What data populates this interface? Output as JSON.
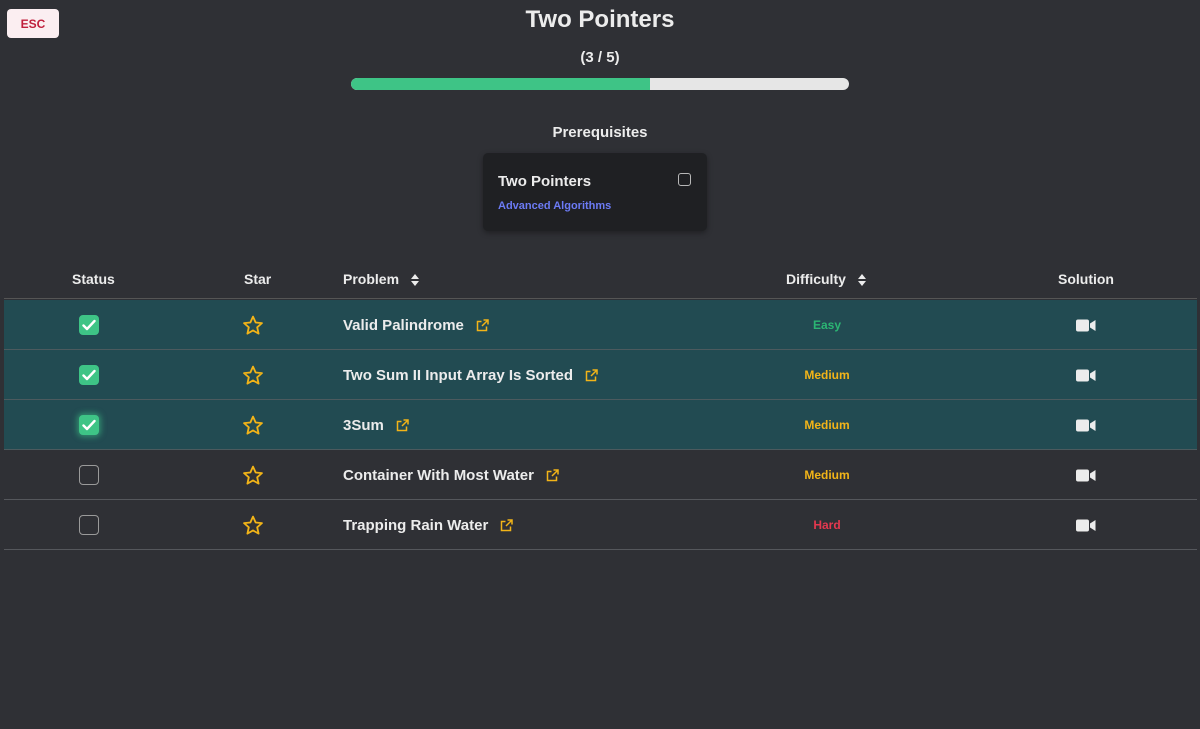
{
  "esc_label": "ESC",
  "title": "Two Pointers",
  "progress": {
    "text": "(3 / 5)",
    "completed": 3,
    "total": 5
  },
  "prerequisites": {
    "heading": "Prerequisites",
    "cards": [
      {
        "title": "Two Pointers",
        "subtitle": "Advanced Algorithms",
        "checked": false
      }
    ]
  },
  "table": {
    "headers": {
      "status": "Status",
      "star": "Star",
      "problem": "Problem",
      "difficulty": "Difficulty",
      "solution": "Solution"
    },
    "rows": [
      {
        "problem": "Valid Palindrome",
        "difficulty": "Easy",
        "completed": true
      },
      {
        "problem": "Two Sum II Input Array Is Sorted",
        "difficulty": "Medium",
        "completed": true
      },
      {
        "problem": "3Sum",
        "difficulty": "Medium",
        "completed": true
      },
      {
        "problem": "Container With Most Water",
        "difficulty": "Medium",
        "completed": false
      },
      {
        "problem": "Trapping Rain Water",
        "difficulty": "Hard",
        "completed": false
      }
    ]
  },
  "colors": {
    "background": "#2f3035",
    "completed_row": "#224b52",
    "accent_green": "#3ec486",
    "star": "#f2b418",
    "easy": "#2bb673",
    "medium": "#f2b418",
    "hard": "#e5384f",
    "link_blue": "#6c7bf5"
  },
  "icons": {
    "star": "star-outline-icon",
    "external": "external-link-icon",
    "solution": "video-camera-icon",
    "sort": "sort-updown-icon",
    "check": "checkmark-icon"
  }
}
